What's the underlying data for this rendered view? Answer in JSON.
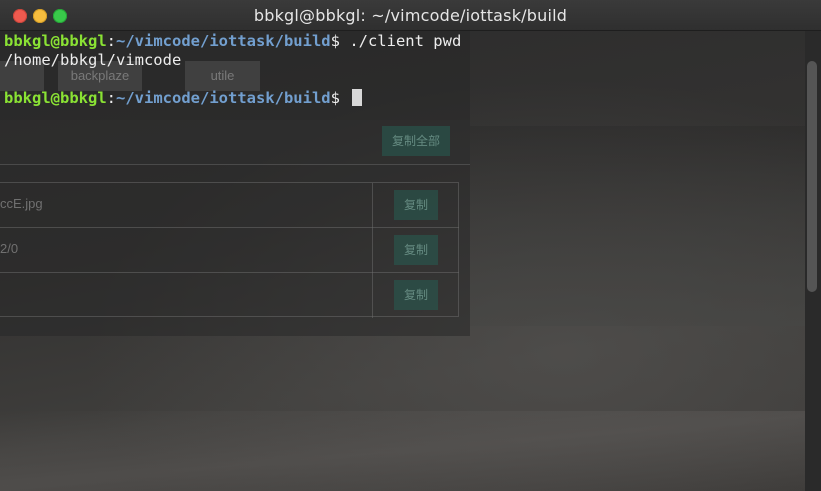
{
  "window": {
    "title": "bbkgl@bbkgl: ~/vimcode/iottask/build",
    "buttons": [
      "close",
      "minimize",
      "maximize"
    ]
  },
  "terminal": {
    "lines": [
      {
        "user": "bbkgl@bbkgl",
        "sep": ":",
        "path": "~/vimcode/iottask/build",
        "prompt": "$",
        "cmd": " ./client pwd"
      },
      {
        "output": "/home/bbkgl/vimcode"
      },
      {
        "blank": ""
      },
      {
        "user": "bbkgl@bbkgl",
        "sep": ":",
        "path": "~/vimcode/iottask/build",
        "prompt": "$",
        "cmd": " "
      }
    ],
    "colors": {
      "user": "#8ae234",
      "path": "#729fcf",
      "text": "#ededed"
    }
  },
  "background_ghost": {
    "chips": [
      "backplaze",
      "utile"
    ],
    "copy_all": "复制全部",
    "rows": [
      {
        "text": "ccE.jpg",
        "button": "复制"
      },
      {
        "text": "2/0",
        "button": "复制"
      },
      {
        "text": "",
        "button": "复制"
      }
    ]
  }
}
